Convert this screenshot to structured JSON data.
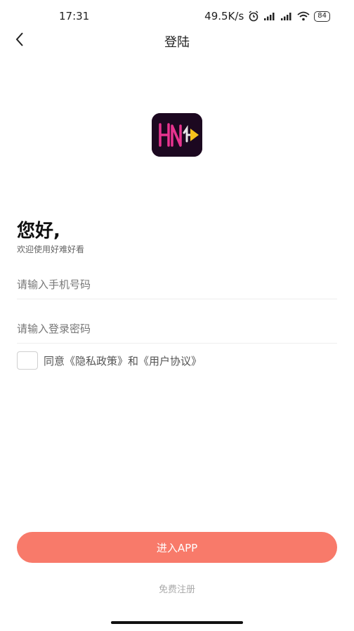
{
  "status_bar": {
    "time": "17:31",
    "speed": "49.5K/s",
    "battery": "84",
    "icons": [
      "alarm-icon",
      "signal-icon",
      "signal-hd-icon",
      "wifi-icon",
      "battery-icon"
    ]
  },
  "nav": {
    "back_icon": "chevron-left-icon",
    "title": "登陆"
  },
  "logo": {
    "text": "HNH",
    "colors": {
      "background": "#1c0820",
      "pink": "#e8338f",
      "yellow": "#f6c21b"
    }
  },
  "greeting": {
    "title": "您好,",
    "subtitle": "欢迎使用好难好看"
  },
  "form": {
    "phone_placeholder": "请输入手机号码",
    "phone_value": "",
    "password_placeholder": "请输入登录密码",
    "password_value": "",
    "agree_checked": false,
    "agree_prefix": "同意",
    "privacy_link": "《隐私政策》",
    "agree_and": "和",
    "terms_link": "《用户协议》"
  },
  "actions": {
    "enter_label": "进入APP",
    "register_label": "免费注册"
  },
  "colors": {
    "accent": "#f87a6a",
    "text_primary": "#111111",
    "text_secondary": "#666666",
    "muted": "#aaaaaa"
  }
}
